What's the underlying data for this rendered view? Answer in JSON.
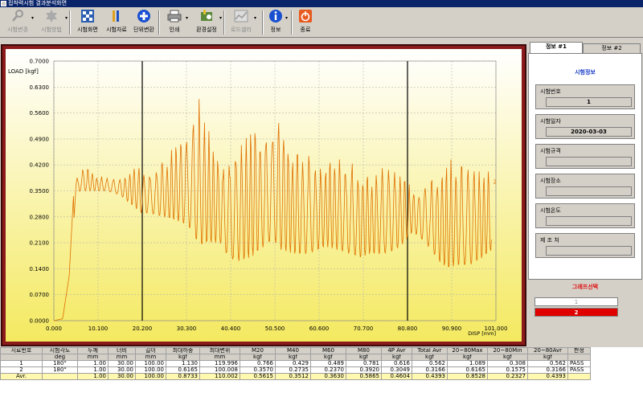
{
  "window": {
    "title": "접착력시험 결과분석화면"
  },
  "toolbar": {
    "buttons": [
      {
        "label": "시험변경",
        "icon": "wrench-icon",
        "enabled": false,
        "dropdown": true
      },
      {
        "label": "시험방법",
        "icon": "gear-icon",
        "enabled": false,
        "dropdown": true
      },
      {
        "label": "시험화면",
        "icon": "grid-icon",
        "enabled": true,
        "dropdown": false
      },
      {
        "label": "시험자료",
        "icon": "bars-icon",
        "enabled": true,
        "dropdown": false
      },
      {
        "label": "단위변환",
        "icon": "plus-circle-icon",
        "enabled": true,
        "dropdown": false
      },
      {
        "label": "인쇄",
        "icon": "printer-icon",
        "enabled": true,
        "dropdown": true
      },
      {
        "label": "환경설정",
        "icon": "settings-icon",
        "enabled": true,
        "dropdown": true
      },
      {
        "label": "로드셀러",
        "icon": "chart-icon",
        "enabled": false,
        "dropdown": true
      },
      {
        "label": "정보",
        "icon": "info-icon",
        "enabled": true,
        "dropdown": true
      },
      {
        "label": "종료",
        "icon": "power-icon",
        "enabled": true,
        "dropdown": false
      }
    ]
  },
  "chart_data": {
    "type": "line",
    "ylabel": "LOAD [kgf]",
    "xlabel": "DISP [mm]",
    "xlim": [
      0,
      101.0
    ],
    "ylim": [
      0,
      0.7
    ],
    "yticks": [
      "0.0000",
      "0.0700",
      "0.1400",
      "0.2100",
      "0.2800",
      "0.3500",
      "0.4200",
      "0.4900",
      "0.5600",
      "0.6300",
      "0.7000"
    ],
    "xticks": [
      "0.000",
      "10.100",
      "20.200",
      "30.300",
      "40.400",
      "50.500",
      "60.600",
      "70.700",
      "80.800",
      "90.900",
      "101.000"
    ],
    "markers_x": [
      20.2,
      80.8
    ],
    "series_label": "2",
    "colors": {
      "line": "#e07000",
      "marker": "#000000",
      "frame": "#8b1a1a"
    },
    "envelope": {
      "x": [
        0,
        2,
        3.5,
        4.5,
        5,
        6,
        8,
        10,
        12,
        15,
        18,
        20,
        22,
        25,
        28,
        30,
        32,
        33,
        35,
        38,
        40,
        42,
        45,
        48,
        50,
        52,
        55,
        58,
        60,
        62,
        65,
        68,
        70,
        72,
        75,
        78,
        80,
        82,
        85,
        88,
        90,
        92,
        95,
        98,
        100
      ],
      "high": [
        0,
        0.005,
        0.12,
        0.34,
        0.38,
        0.42,
        0.41,
        0.39,
        0.39,
        0.38,
        0.42,
        0.43,
        0.41,
        0.44,
        0.48,
        0.5,
        0.56,
        0.61,
        0.53,
        0.46,
        0.43,
        0.5,
        0.55,
        0.54,
        0.57,
        0.53,
        0.49,
        0.47,
        0.44,
        0.45,
        0.45,
        0.44,
        0.43,
        0.41,
        0.42,
        0.43,
        0.42,
        0.36,
        0.37,
        0.42,
        0.44,
        0.45,
        0.43,
        0.41,
        0.42
      ],
      "low": [
        0,
        0.002,
        0.06,
        0.26,
        0.33,
        0.35,
        0.35,
        0.35,
        0.35,
        0.34,
        0.31,
        0.29,
        0.29,
        0.28,
        0.27,
        0.26,
        0.24,
        0.2,
        0.21,
        0.21,
        0.17,
        0.16,
        0.17,
        0.2,
        0.22,
        0.19,
        0.18,
        0.18,
        0.19,
        0.2,
        0.19,
        0.18,
        0.17,
        0.18,
        0.18,
        0.19,
        0.21,
        0.24,
        0.21,
        0.16,
        0.14,
        0.15,
        0.15,
        0.17,
        0.19
      ]
    }
  },
  "side": {
    "tabs": [
      "정보 #1",
      "정보 #2"
    ],
    "title": "시험정보",
    "fields": [
      {
        "label": "시험번호",
        "value": "1"
      },
      {
        "label": "시험일자",
        "value": "2020-03-03"
      },
      {
        "label": "시험규격",
        "value": ""
      },
      {
        "label": "시험장소",
        "value": ""
      },
      {
        "label": "시험온도",
        "value": ""
      },
      {
        "label": "제 조 처",
        "value": ""
      }
    ]
  },
  "graph_select": {
    "title": "그래프선택",
    "items": [
      "1",
      "2"
    ]
  },
  "results": {
    "headers": [
      "시료번호",
      "시험각도",
      "두께",
      "너비",
      "길이",
      "최대하중",
      "최대변위",
      "M20",
      "M40",
      "M60",
      "M80",
      "4P Avr",
      "Total Avr",
      "20~80Max",
      "20~80Min",
      "20~80Avr",
      "판정"
    ],
    "units": [
      "",
      "deg",
      "mm",
      "mm",
      "mm",
      "kgf",
      "mm",
      "kgf",
      "kgf",
      "kgf",
      "kgf",
      "kgf",
      "kgf",
      "kgf",
      "kgf",
      "kgf",
      ""
    ],
    "rows": [
      [
        "1",
        "180°",
        "1.00",
        "30.00",
        "100.00",
        "1.130",
        "119.996",
        "0.766",
        "0.429",
        "0.489",
        "0.781",
        "0.616",
        "0.562",
        "1.089",
        "0.308",
        "0.562",
        "PASS"
      ],
      [
        "2",
        "180°",
        "1.00",
        "30.00",
        "100.00",
        "0.6165",
        "100.008",
        "0.3570",
        "0.2735",
        "0.2370",
        "0.3920",
        "0.3049",
        "0.3166",
        "0.6165",
        "0.1575",
        "0.3166",
        "PASS"
      ]
    ],
    "avg": [
      "Avr.",
      "",
      "1.00",
      "30.00",
      "100.00",
      "0.8733",
      "110.002",
      "0.5615",
      "0.3512",
      "0.3630",
      "0.5865",
      "0.4604",
      "0.4393",
      "0.8528",
      "0.2327",
      "0.4393",
      ""
    ]
  }
}
